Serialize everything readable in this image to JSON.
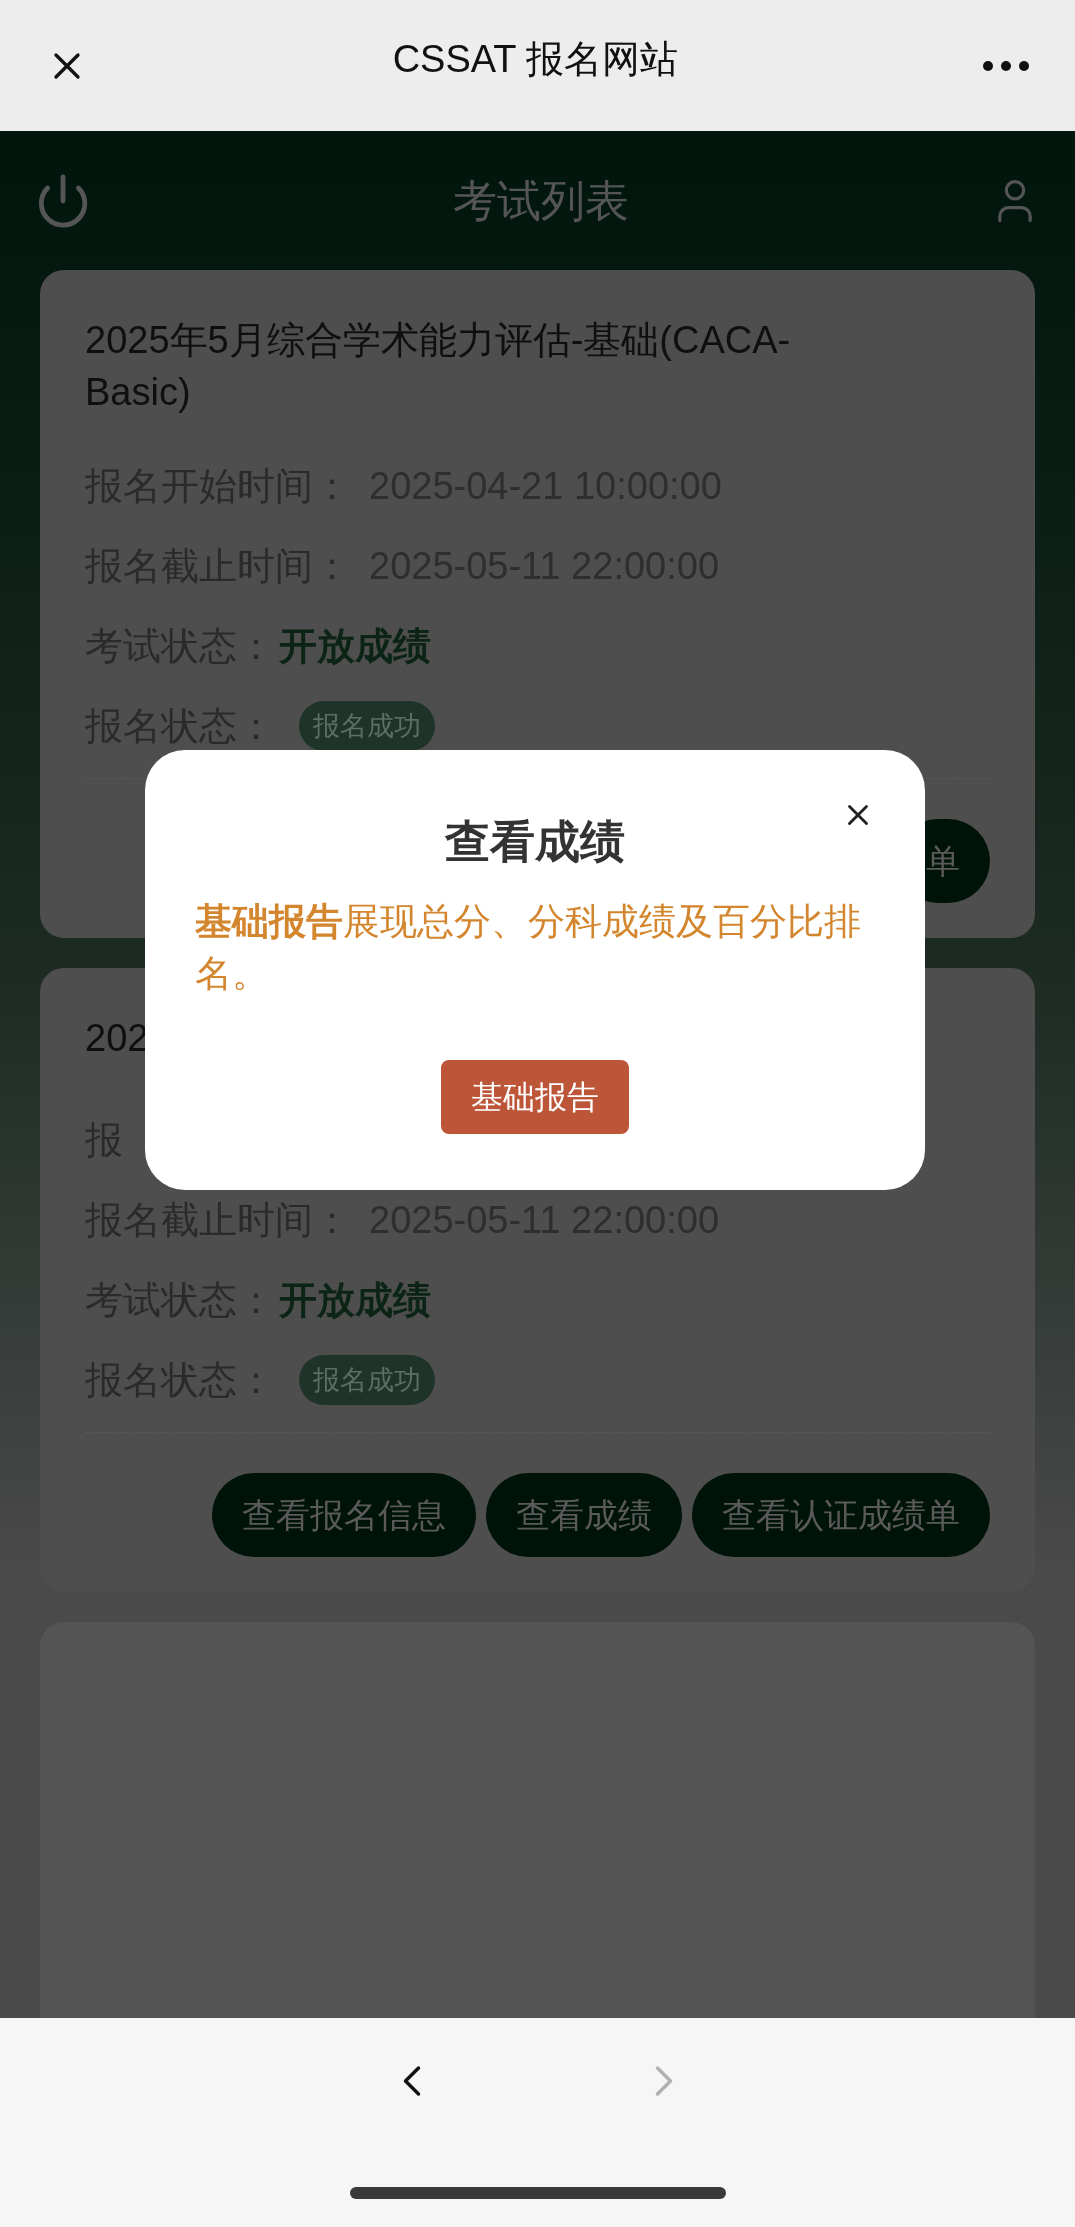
{
  "top_bar": {
    "title": "CSSAT 报名网站"
  },
  "page_header": {
    "title": "考试列表"
  },
  "exams": [
    {
      "kind": "exam",
      "title": "2025年5月综合学术能力评估-基础(CACA-Basic)",
      "fields": [
        {
          "kind": "text",
          "label": "报名开始时间：",
          "value": "2025-04-21 10:00:00"
        },
        {
          "kind": "text",
          "label": "报名截止时间：",
          "value": "2025-05-11 22:00:00"
        },
        {
          "kind": "status",
          "label": "考试状态：",
          "value": "开放成绩"
        },
        {
          "kind": "badge",
          "label": "报名状态：",
          "value": "报名成功"
        }
      ],
      "buttons": [
        "单"
      ]
    },
    {
      "kind": "exam",
      "title": "202",
      "fields": [
        {
          "kind": "text",
          "label": "报"
        },
        {
          "kind": "text",
          "label": "报名截止时间：",
          "value": "2025-05-11 22:00:00"
        },
        {
          "kind": "status",
          "label": "考试状态：",
          "value": "开放成绩"
        },
        {
          "kind": "badge",
          "label": "报名状态：",
          "value": "报名成功"
        }
      ],
      "buttons": [
        "查看报名信息",
        "查看成绩",
        "查看认证成绩单"
      ]
    },
    {
      "kind": "blank"
    }
  ],
  "dialog": {
    "title": "查看成绩",
    "text": "**基础报告**展现总分、分科成绩及百分比排名。",
    "button": "基础报告"
  },
  "nav": {
    "back_enabled": true,
    "forward_enabled": false
  }
}
